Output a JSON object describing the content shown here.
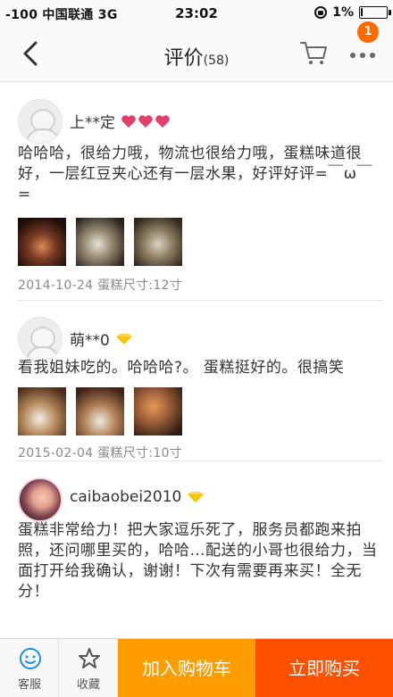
{
  "status_bar": {
    "carrier": "-100 中国联通  3G",
    "time": "23:02",
    "battery": "1%"
  },
  "nav": {
    "title": "评价",
    "count": "(58)",
    "badge": "1"
  },
  "reviews": [
    {
      "user": "上**定",
      "content": "哈哈哈，很给力哦，物流也很给力哦，蛋糕味道很好，一层红豆夹心还有一层水果，好评好评=￣ω￣=",
      "meta": "2014-10-24  蛋糕尺寸:12寸"
    },
    {
      "user": "萌**0",
      "content": "看我姐妹吃的。哈哈哈?。 蛋糕挺好的。很搞笑",
      "meta": "2015-02-04  蛋糕尺寸:10寸"
    },
    {
      "user": "caibaobei2010",
      "content": "蛋糕非常给力！把大家逗乐死了，服务员都跑来拍照，还问哪里买的，哈哈…配送的小哥也很给力，当面打开给我确认，谢谢！下次有需要再来买！全无分！"
    }
  ],
  "bottom_bar": {
    "service_label": "客服",
    "favorite_label": "收藏",
    "add_to_cart_label": "加入购物车",
    "buy_now_label": "立即购买"
  },
  "colors": {
    "add_to_cart": "#ff9c00",
    "buy_now": "#ff5000",
    "badge": "#ff6a00",
    "heart": "#e0406a",
    "crown": "#f5c400"
  },
  "icons": [
    "back-icon",
    "cart-icon",
    "more-icon",
    "heart-icon",
    "crown-icon",
    "service-icon",
    "star-icon",
    "lock-icon",
    "battery-icon"
  ]
}
